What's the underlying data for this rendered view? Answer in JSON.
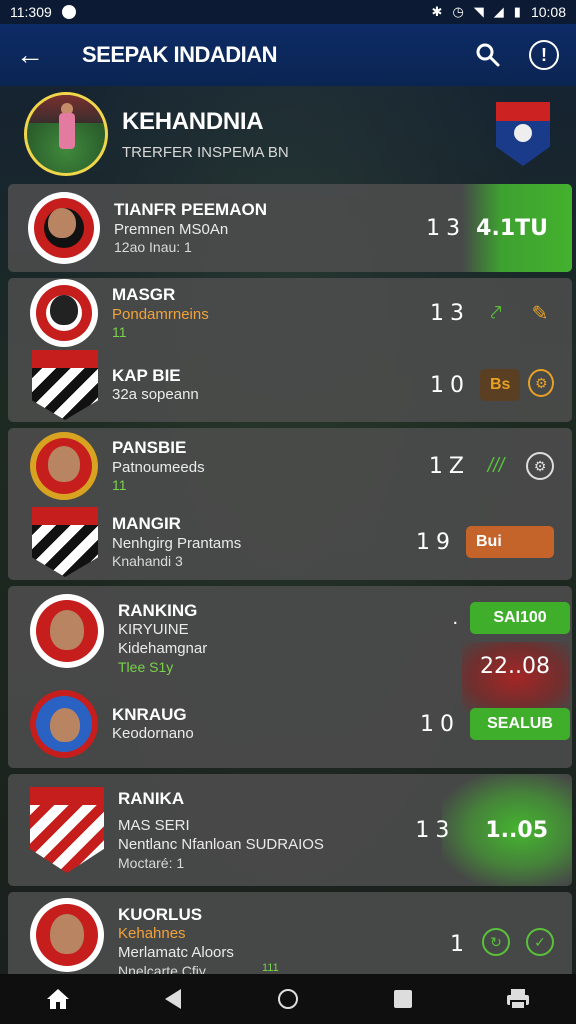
{
  "status_bar": {
    "time": "11:309",
    "right_time": "10:08"
  },
  "app_bar": {
    "title": "SEEPAK INDADIAN"
  },
  "profile": {
    "name": "KEHANDNIA",
    "subtitle": "TRERFER INSPEMA BN"
  },
  "cards": [
    {
      "rows": [
        {
          "title": "TIANFR PEEMAON",
          "line2": "Premnen MS0An",
          "line3": "12ao Inau: 1",
          "score": "13",
          "value": "4.1TU"
        }
      ]
    },
    {
      "rows": [
        {
          "title": "MASGR",
          "line2": "Pondamrneins",
          "line3": "11",
          "score": "13"
        },
        {
          "title": "KAP BIE",
          "line2": "32a sopeann",
          "line3": "",
          "score": "10",
          "pill": "Bs"
        }
      ]
    },
    {
      "rows": [
        {
          "title": "PANSBIE",
          "line2": "Patnoumeeds",
          "line3": "11",
          "score": "1Z",
          "extra": "///"
        },
        {
          "title": "MANGIR",
          "line2": "Nenhgirg Prantams",
          "line3": "Knahandi 3",
          "score": "19",
          "pill": "Bui"
        }
      ]
    },
    {
      "rows": [
        {
          "title": "RANKING",
          "line2": "KIRYUINE",
          "line3": "Kidehamgnar",
          "line4": "Tlee S1y",
          "pill": "SAI100"
        },
        {
          "title": "KNRAUG",
          "line2": "Keodornano",
          "score": "10",
          "pill": "SEALUB",
          "value": "22..08"
        }
      ]
    },
    {
      "rows": [
        {
          "title": "RANIKA",
          "line2": "MAS SERI",
          "line3": "Nentlanc Nfanloan SUDRAIOS",
          "line4": "Moctaré: 1",
          "score": "13",
          "value": "1..05"
        }
      ]
    },
    {
      "rows": [
        {
          "title": "KUORLUS",
          "line2": "Kehahnes",
          "line3": "Merlamatc Aloors",
          "line4": "Nnelcarte Cfiy",
          "score": "1",
          "tiny": "111"
        }
      ]
    }
  ]
}
